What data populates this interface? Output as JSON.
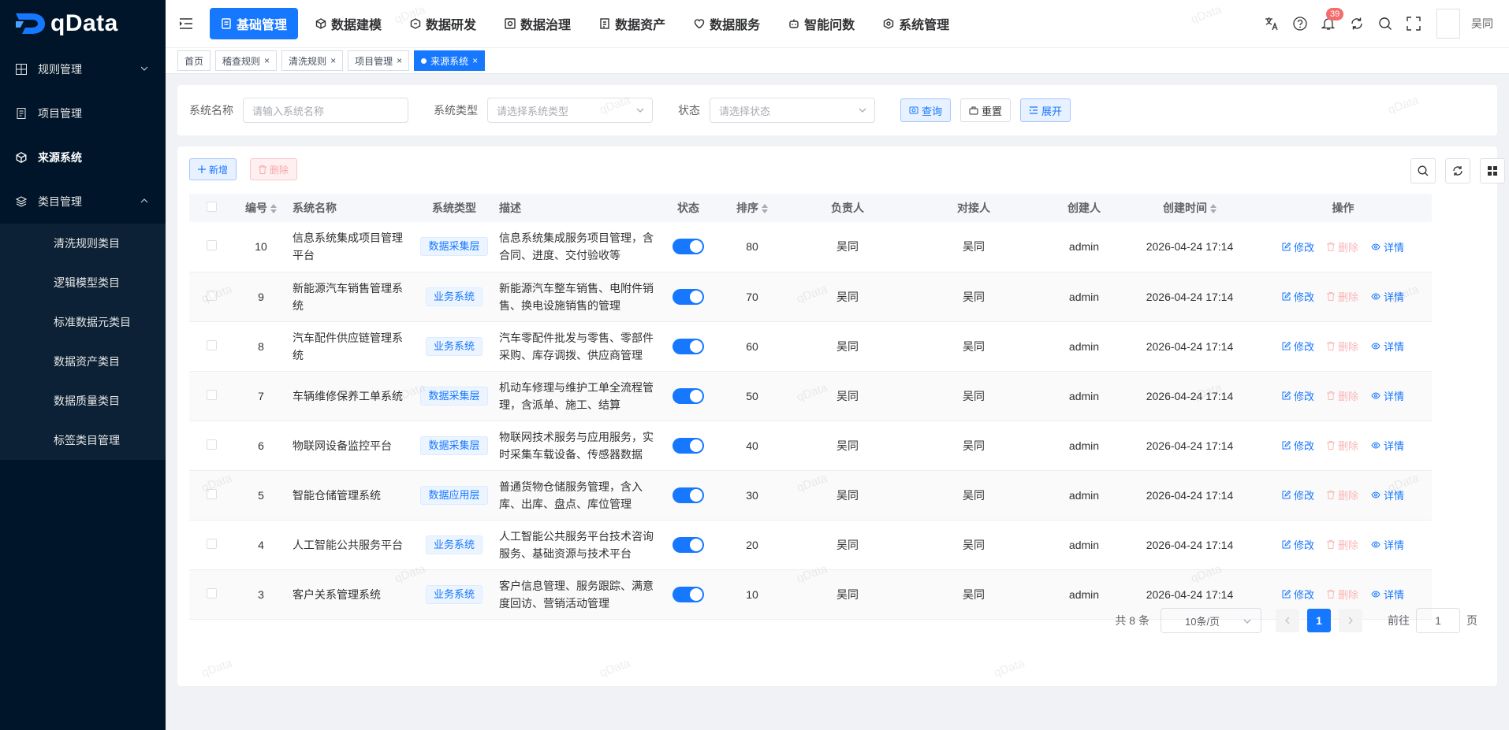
{
  "brand": {
    "name": "qData"
  },
  "sidebar": {
    "items": [
      {
        "label": "规则管理",
        "icon": "grid-icon",
        "has_chevron": true,
        "expanded": false
      },
      {
        "label": "项目管理",
        "icon": "document-icon",
        "has_chevron": false
      },
      {
        "label": "来源系统",
        "icon": "cube-icon",
        "has_chevron": false,
        "active": true
      },
      {
        "label": "类目管理",
        "icon": "layers-icon",
        "has_chevron": true,
        "expanded": true
      }
    ],
    "subitems": [
      {
        "label": "清洗规则类目"
      },
      {
        "label": "逻辑模型类目"
      },
      {
        "label": "标准数据元类目"
      },
      {
        "label": "数据资产类目"
      },
      {
        "label": "数据质量类目"
      },
      {
        "label": "标签类目管理"
      }
    ]
  },
  "header": {
    "nav": [
      {
        "label": "基础管理",
        "active": true
      },
      {
        "label": "数据建模"
      },
      {
        "label": "数据研发"
      },
      {
        "label": "数据治理"
      },
      {
        "label": "数据资产"
      },
      {
        "label": "数据服务"
      },
      {
        "label": "智能问数"
      },
      {
        "label": "系统管理"
      }
    ],
    "notification_count": "39",
    "username": "吴同"
  },
  "tabs": [
    {
      "label": "首页",
      "closable": false
    },
    {
      "label": "稽查规则",
      "closable": true
    },
    {
      "label": "清洗规则",
      "closable": true
    },
    {
      "label": "项目管理",
      "closable": true
    },
    {
      "label": "来源系统",
      "closable": true,
      "active": true
    }
  ],
  "search": {
    "name_label": "系统名称",
    "name_placeholder": "请输入系统名称",
    "type_label": "系统类型",
    "type_placeholder": "请选择系统类型",
    "status_label": "状态",
    "status_placeholder": "请选择状态",
    "query_label": "查询",
    "reset_label": "重置",
    "expand_label": "展开"
  },
  "toolbar": {
    "add_label": "新增",
    "delete_label": "删除"
  },
  "table": {
    "columns": [
      "编号",
      "系统名称",
      "系统类型",
      "描述",
      "状态",
      "排序",
      "负责人",
      "对接人",
      "创建人",
      "创建时间",
      "操作"
    ],
    "ops": {
      "edit": "修改",
      "delete": "删除",
      "detail": "详情"
    },
    "rows": [
      {
        "id": "10",
        "name": "信息系统集成项目管理平台",
        "type": "数据采集层",
        "desc": "信息系统集成服务项目管理，含合同、进度、交付验收等",
        "status": true,
        "sort": "80",
        "owner": "吴同",
        "contact": "吴同",
        "creator": "admin",
        "created": "2026-04-24 17:14"
      },
      {
        "id": "9",
        "name": "新能源汽车销售管理系统",
        "type": "业务系统",
        "desc": "新能源汽车整车销售、电附件销售、换电设施销售的管理",
        "status": true,
        "sort": "70",
        "owner": "吴同",
        "contact": "吴同",
        "creator": "admin",
        "created": "2026-04-24 17:14"
      },
      {
        "id": "8",
        "name": "汽车配件供应链管理系统",
        "type": "业务系统",
        "desc": "汽车零配件批发与零售、零部件采购、库存调拨、供应商管理",
        "status": true,
        "sort": "60",
        "owner": "吴同",
        "contact": "吴同",
        "creator": "admin",
        "created": "2026-04-24 17:14"
      },
      {
        "id": "7",
        "name": "车辆维修保养工单系统",
        "type": "数据采集层",
        "desc": "机动车修理与维护工单全流程管理，含派单、施工、结算",
        "status": true,
        "sort": "50",
        "owner": "吴同",
        "contact": "吴同",
        "creator": "admin",
        "created": "2026-04-24 17:14"
      },
      {
        "id": "6",
        "name": "物联网设备监控平台",
        "type": "数据采集层",
        "desc": "物联网技术服务与应用服务，实时采集车载设备、传感器数据",
        "status": true,
        "sort": "40",
        "owner": "吴同",
        "contact": "吴同",
        "creator": "admin",
        "created": "2026-04-24 17:14"
      },
      {
        "id": "5",
        "name": "智能仓储管理系统",
        "type": "数据应用层",
        "desc": "普通货物仓储服务管理，含入库、出库、盘点、库位管理",
        "status": true,
        "sort": "30",
        "owner": "吴同",
        "contact": "吴同",
        "creator": "admin",
        "created": "2026-04-24 17:14"
      },
      {
        "id": "4",
        "name": "人工智能公共服务平台",
        "type": "业务系统",
        "desc": "人工智能公共服务平台技术咨询服务、基础资源与技术平台",
        "status": true,
        "sort": "20",
        "owner": "吴同",
        "contact": "吴同",
        "creator": "admin",
        "created": "2026-04-24 17:14"
      },
      {
        "id": "3",
        "name": "客户关系管理系统",
        "type": "业务系统",
        "desc": "客户信息管理、服务跟踪、满意度回访、营销活动管理",
        "status": true,
        "sort": "10",
        "owner": "吴同",
        "contact": "吴同",
        "creator": "admin",
        "created": "2026-04-24 17:14"
      }
    ]
  },
  "pagination": {
    "total": "共 8 条",
    "page_size": "10条/页",
    "current": "1",
    "goto_label": "前往",
    "goto_value": "1",
    "page_unit": "页"
  },
  "watermark": "qData"
}
